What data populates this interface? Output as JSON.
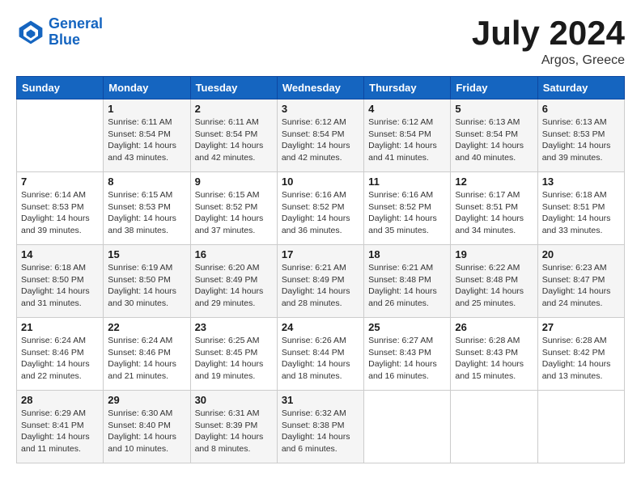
{
  "logo": {
    "line1": "General",
    "line2": "Blue"
  },
  "title": {
    "month_year": "July 2024",
    "location": "Argos, Greece"
  },
  "days_of_week": [
    "Sunday",
    "Monday",
    "Tuesday",
    "Wednesday",
    "Thursday",
    "Friday",
    "Saturday"
  ],
  "weeks": [
    [
      {
        "day": "",
        "info": ""
      },
      {
        "day": "1",
        "info": "Sunrise: 6:11 AM\nSunset: 8:54 PM\nDaylight: 14 hours\nand 43 minutes."
      },
      {
        "day": "2",
        "info": "Sunrise: 6:11 AM\nSunset: 8:54 PM\nDaylight: 14 hours\nand 42 minutes."
      },
      {
        "day": "3",
        "info": "Sunrise: 6:12 AM\nSunset: 8:54 PM\nDaylight: 14 hours\nand 42 minutes."
      },
      {
        "day": "4",
        "info": "Sunrise: 6:12 AM\nSunset: 8:54 PM\nDaylight: 14 hours\nand 41 minutes."
      },
      {
        "day": "5",
        "info": "Sunrise: 6:13 AM\nSunset: 8:54 PM\nDaylight: 14 hours\nand 40 minutes."
      },
      {
        "day": "6",
        "info": "Sunrise: 6:13 AM\nSunset: 8:53 PM\nDaylight: 14 hours\nand 39 minutes."
      }
    ],
    [
      {
        "day": "7",
        "info": "Sunrise: 6:14 AM\nSunset: 8:53 PM\nDaylight: 14 hours\nand 39 minutes."
      },
      {
        "day": "8",
        "info": "Sunrise: 6:15 AM\nSunset: 8:53 PM\nDaylight: 14 hours\nand 38 minutes."
      },
      {
        "day": "9",
        "info": "Sunrise: 6:15 AM\nSunset: 8:52 PM\nDaylight: 14 hours\nand 37 minutes."
      },
      {
        "day": "10",
        "info": "Sunrise: 6:16 AM\nSunset: 8:52 PM\nDaylight: 14 hours\nand 36 minutes."
      },
      {
        "day": "11",
        "info": "Sunrise: 6:16 AM\nSunset: 8:52 PM\nDaylight: 14 hours\nand 35 minutes."
      },
      {
        "day": "12",
        "info": "Sunrise: 6:17 AM\nSunset: 8:51 PM\nDaylight: 14 hours\nand 34 minutes."
      },
      {
        "day": "13",
        "info": "Sunrise: 6:18 AM\nSunset: 8:51 PM\nDaylight: 14 hours\nand 33 minutes."
      }
    ],
    [
      {
        "day": "14",
        "info": "Sunrise: 6:18 AM\nSunset: 8:50 PM\nDaylight: 14 hours\nand 31 minutes."
      },
      {
        "day": "15",
        "info": "Sunrise: 6:19 AM\nSunset: 8:50 PM\nDaylight: 14 hours\nand 30 minutes."
      },
      {
        "day": "16",
        "info": "Sunrise: 6:20 AM\nSunset: 8:49 PM\nDaylight: 14 hours\nand 29 minutes."
      },
      {
        "day": "17",
        "info": "Sunrise: 6:21 AM\nSunset: 8:49 PM\nDaylight: 14 hours\nand 28 minutes."
      },
      {
        "day": "18",
        "info": "Sunrise: 6:21 AM\nSunset: 8:48 PM\nDaylight: 14 hours\nand 26 minutes."
      },
      {
        "day": "19",
        "info": "Sunrise: 6:22 AM\nSunset: 8:48 PM\nDaylight: 14 hours\nand 25 minutes."
      },
      {
        "day": "20",
        "info": "Sunrise: 6:23 AM\nSunset: 8:47 PM\nDaylight: 14 hours\nand 24 minutes."
      }
    ],
    [
      {
        "day": "21",
        "info": "Sunrise: 6:24 AM\nSunset: 8:46 PM\nDaylight: 14 hours\nand 22 minutes."
      },
      {
        "day": "22",
        "info": "Sunrise: 6:24 AM\nSunset: 8:46 PM\nDaylight: 14 hours\nand 21 minutes."
      },
      {
        "day": "23",
        "info": "Sunrise: 6:25 AM\nSunset: 8:45 PM\nDaylight: 14 hours\nand 19 minutes."
      },
      {
        "day": "24",
        "info": "Sunrise: 6:26 AM\nSunset: 8:44 PM\nDaylight: 14 hours\nand 18 minutes."
      },
      {
        "day": "25",
        "info": "Sunrise: 6:27 AM\nSunset: 8:43 PM\nDaylight: 14 hours\nand 16 minutes."
      },
      {
        "day": "26",
        "info": "Sunrise: 6:28 AM\nSunset: 8:43 PM\nDaylight: 14 hours\nand 15 minutes."
      },
      {
        "day": "27",
        "info": "Sunrise: 6:28 AM\nSunset: 8:42 PM\nDaylight: 14 hours\nand 13 minutes."
      }
    ],
    [
      {
        "day": "28",
        "info": "Sunrise: 6:29 AM\nSunset: 8:41 PM\nDaylight: 14 hours\nand 11 minutes."
      },
      {
        "day": "29",
        "info": "Sunrise: 6:30 AM\nSunset: 8:40 PM\nDaylight: 14 hours\nand 10 minutes."
      },
      {
        "day": "30",
        "info": "Sunrise: 6:31 AM\nSunset: 8:39 PM\nDaylight: 14 hours\nand 8 minutes."
      },
      {
        "day": "31",
        "info": "Sunrise: 6:32 AM\nSunset: 8:38 PM\nDaylight: 14 hours\nand 6 minutes."
      },
      {
        "day": "",
        "info": ""
      },
      {
        "day": "",
        "info": ""
      },
      {
        "day": "",
        "info": ""
      }
    ]
  ]
}
